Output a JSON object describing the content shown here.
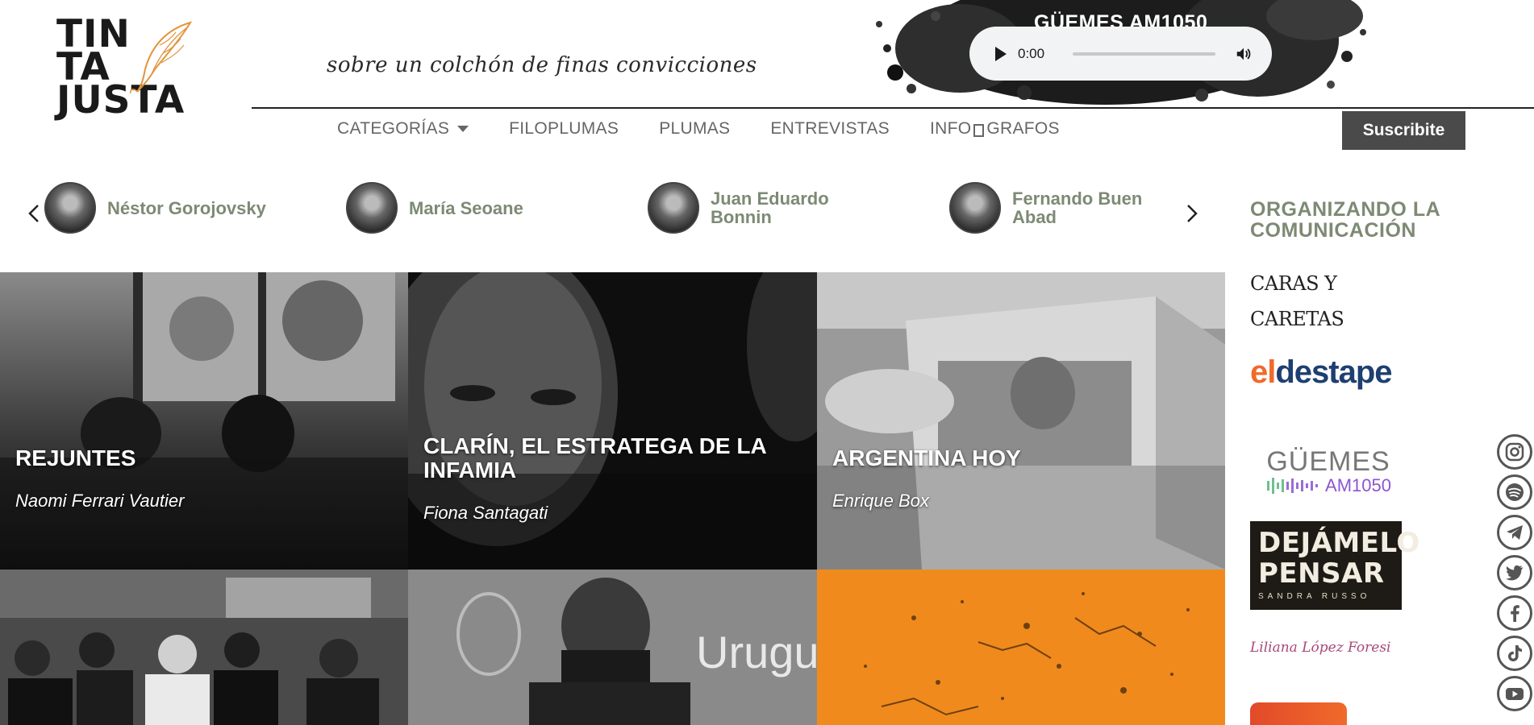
{
  "header": {
    "logo_lines": [
      "TIN",
      "TA",
      "JUSTA"
    ],
    "tagline": "sobre un colchón de finas convicciones",
    "radio_title": "GÜEMES AM1050",
    "audio_time": "0:00"
  },
  "nav": {
    "items": [
      "CATEGORÍAS",
      "FILOPLUMAS",
      "PLUMAS",
      "ENTREVISTAS"
    ],
    "info_left": "INFO",
    "info_right": "GRAFOS",
    "subscribe": "Suscribite"
  },
  "authors": [
    {
      "name": "Néstor Gorojovsky"
    },
    {
      "name": "María Seoane"
    },
    {
      "name": "Juan Eduardo Bonnin"
    },
    {
      "name": "Fernando Buen Abad"
    }
  ],
  "sidebar": {
    "title": "ORGANIZANDO LA COMUNICACIÓN",
    "media": [
      {
        "name": "Caras y Caretas",
        "text": "CARAS Y CARETAS"
      },
      {
        "name": "El Destape",
        "text_el": "el",
        "text_destape": "destape"
      },
      {
        "name": "Güemes AM1050",
        "line1": "GÜEMES",
        "line2": "AM1050"
      },
      {
        "name": "Dejámelo Pensar",
        "line1": "DEJÁMELO",
        "line2": "PENSAR",
        "line3": "SANDRA RUSSO"
      },
      {
        "name": "Liliana López Foresi",
        "text": "Liliana López Foresi"
      }
    ]
  },
  "articles": [
    {
      "title": "REJUNTES",
      "author": "Naomi Ferrari Vautier"
    },
    {
      "title": "CLARÍN, EL ESTRATEGA DE LA INFAMIA",
      "author": "Fiona Santagati"
    },
    {
      "title": "ARGENTINA HOY",
      "author": "Enrique Box"
    },
    {
      "title": "",
      "author": ""
    },
    {
      "title": "",
      "author": "",
      "bg_text": "Urugu"
    },
    {
      "title": "",
      "author": ""
    }
  ],
  "social": [
    "instagram-icon",
    "spotify-icon",
    "telegram-icon",
    "twitter-icon",
    "facebook-icon",
    "tiktok-icon",
    "youtube-icon"
  ],
  "colors": {
    "accent_green": "#7d8a74",
    "subscribe_bg": "#4a4a4a",
    "orange": "#f08a1d"
  }
}
